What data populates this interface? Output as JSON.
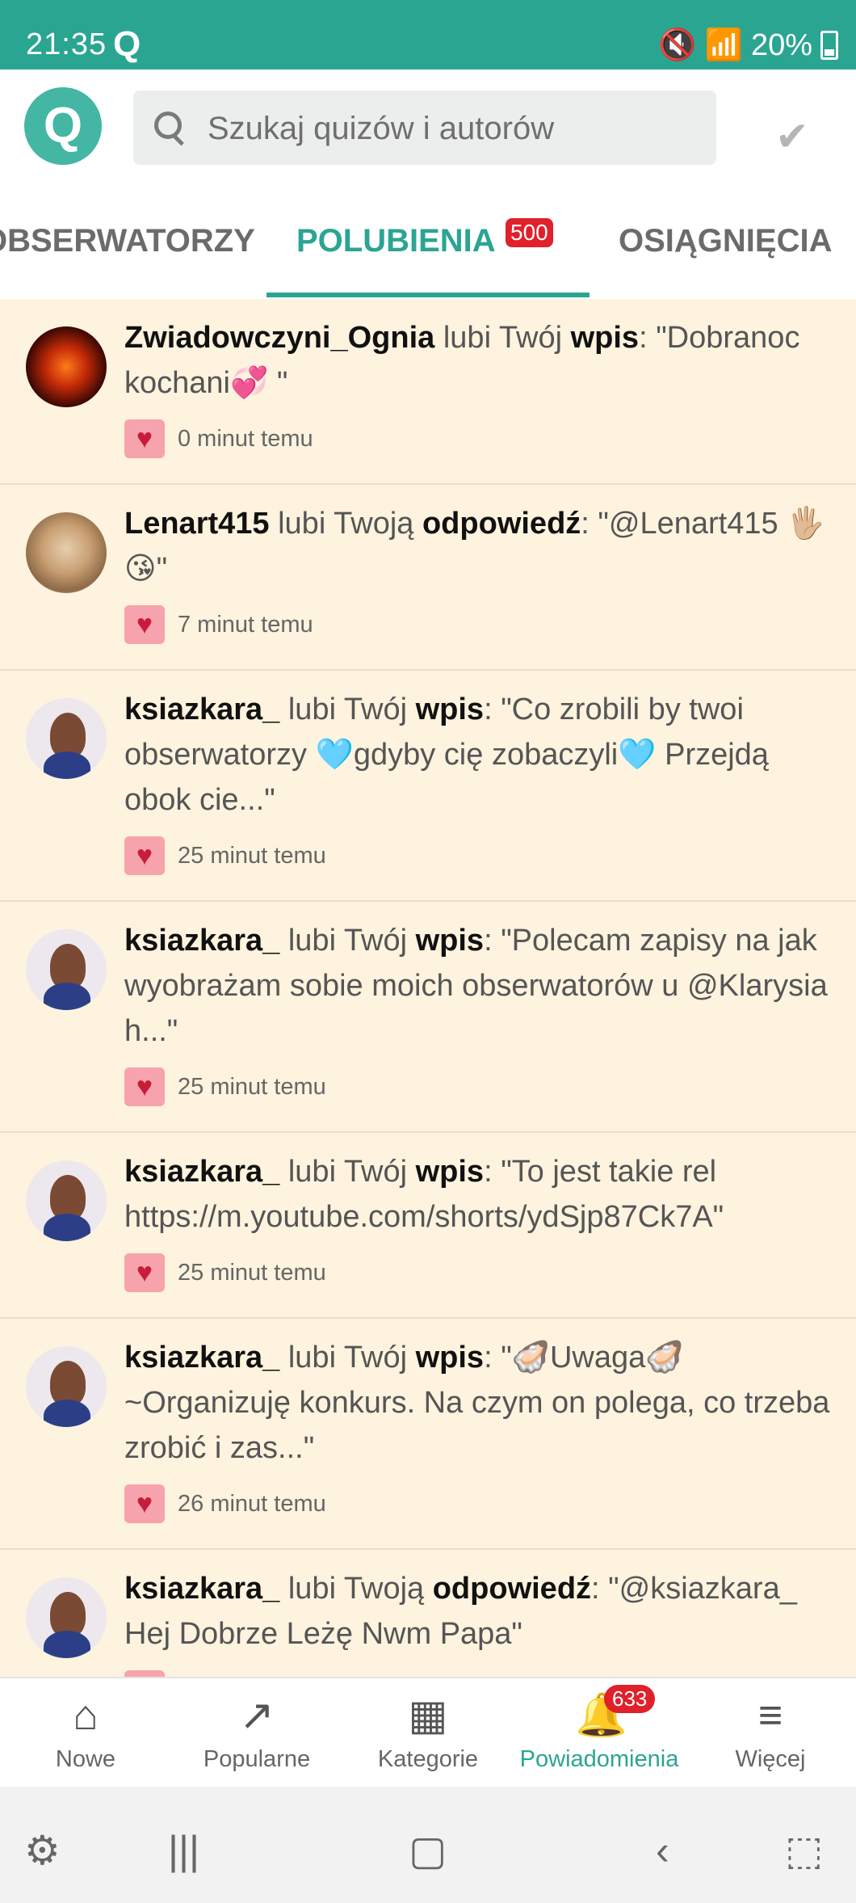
{
  "status_bar": {
    "time": "21:35",
    "app_glyph": "Q",
    "battery": "20%"
  },
  "header": {
    "logo_letter": "Q",
    "search_placeholder": "Szukaj quizów i autorów"
  },
  "tabs": [
    {
      "label": "OBSERWATORZY"
    },
    {
      "label": "POLUBIENIA",
      "badge": "500",
      "active": true
    },
    {
      "label": "OSIĄGNIĘCIA"
    }
  ],
  "notifications": [
    {
      "user": "Zwiadowczyni_Ognia",
      "action": "lubi Twój",
      "object": "wpis",
      "content": "\"Dobranoc kochani💞 \"",
      "time": "0 minut temu"
    },
    {
      "user": "Lenart415",
      "action": "lubi Twoją",
      "object": "odpowiedź",
      "content": "\"@Lenart415 🖐🏼😘\"",
      "time": "7 minut temu"
    },
    {
      "user": "ksiazkara_",
      "action": "lubi Twój",
      "object": "wpis",
      "content": "\"Co zrobili by twoi obserwatorzy 🩵gdyby cię zobaczyli🩵 Przejdą obok cie...\"",
      "time": "25 minut temu"
    },
    {
      "user": "ksiazkara_",
      "action": "lubi Twój",
      "object": "wpis",
      "content": "\"Polecam zapisy na jak wyobrażam sobie moich obserwatorów u @Klarysia h...\"",
      "time": "25 minut temu"
    },
    {
      "user": "ksiazkara_",
      "action": "lubi Twój",
      "object": "wpis",
      "content": "\"To jest takie rel https://m.youtube.com/shorts/ydSjp87Ck7A\"",
      "time": "25 minut temu"
    },
    {
      "user": "ksiazkara_",
      "action": "lubi Twój",
      "object": "wpis",
      "content": "\"🦪Uwaga🦪 ~Organizuję konkurs. Na czym on polega, co trzeba zrobić i zas...\"",
      "time": "26 minut temu"
    },
    {
      "user": "ksiazkara_",
      "action": "lubi Twoją",
      "object": "odpowiedź",
      "content": "\"@ksiazkara_ Hej Dobrze Leżę Nwm Papa\"",
      "time": ""
    }
  ],
  "bottom_nav": [
    {
      "label": "Nowe",
      "icon": "home-icon"
    },
    {
      "label": "Popularne",
      "icon": "trending-icon"
    },
    {
      "label": "Kategorie",
      "icon": "grid-icon"
    },
    {
      "label": "Powiadomienia",
      "icon": "bell-icon",
      "badge": "633",
      "active": true
    },
    {
      "label": "Więcej",
      "icon": "menu-icon"
    }
  ],
  "colors": {
    "accent": "#2aa592",
    "badge": "#e0202a",
    "list_bg": "#fdf3de",
    "heart_bg": "#f7a3ad"
  }
}
